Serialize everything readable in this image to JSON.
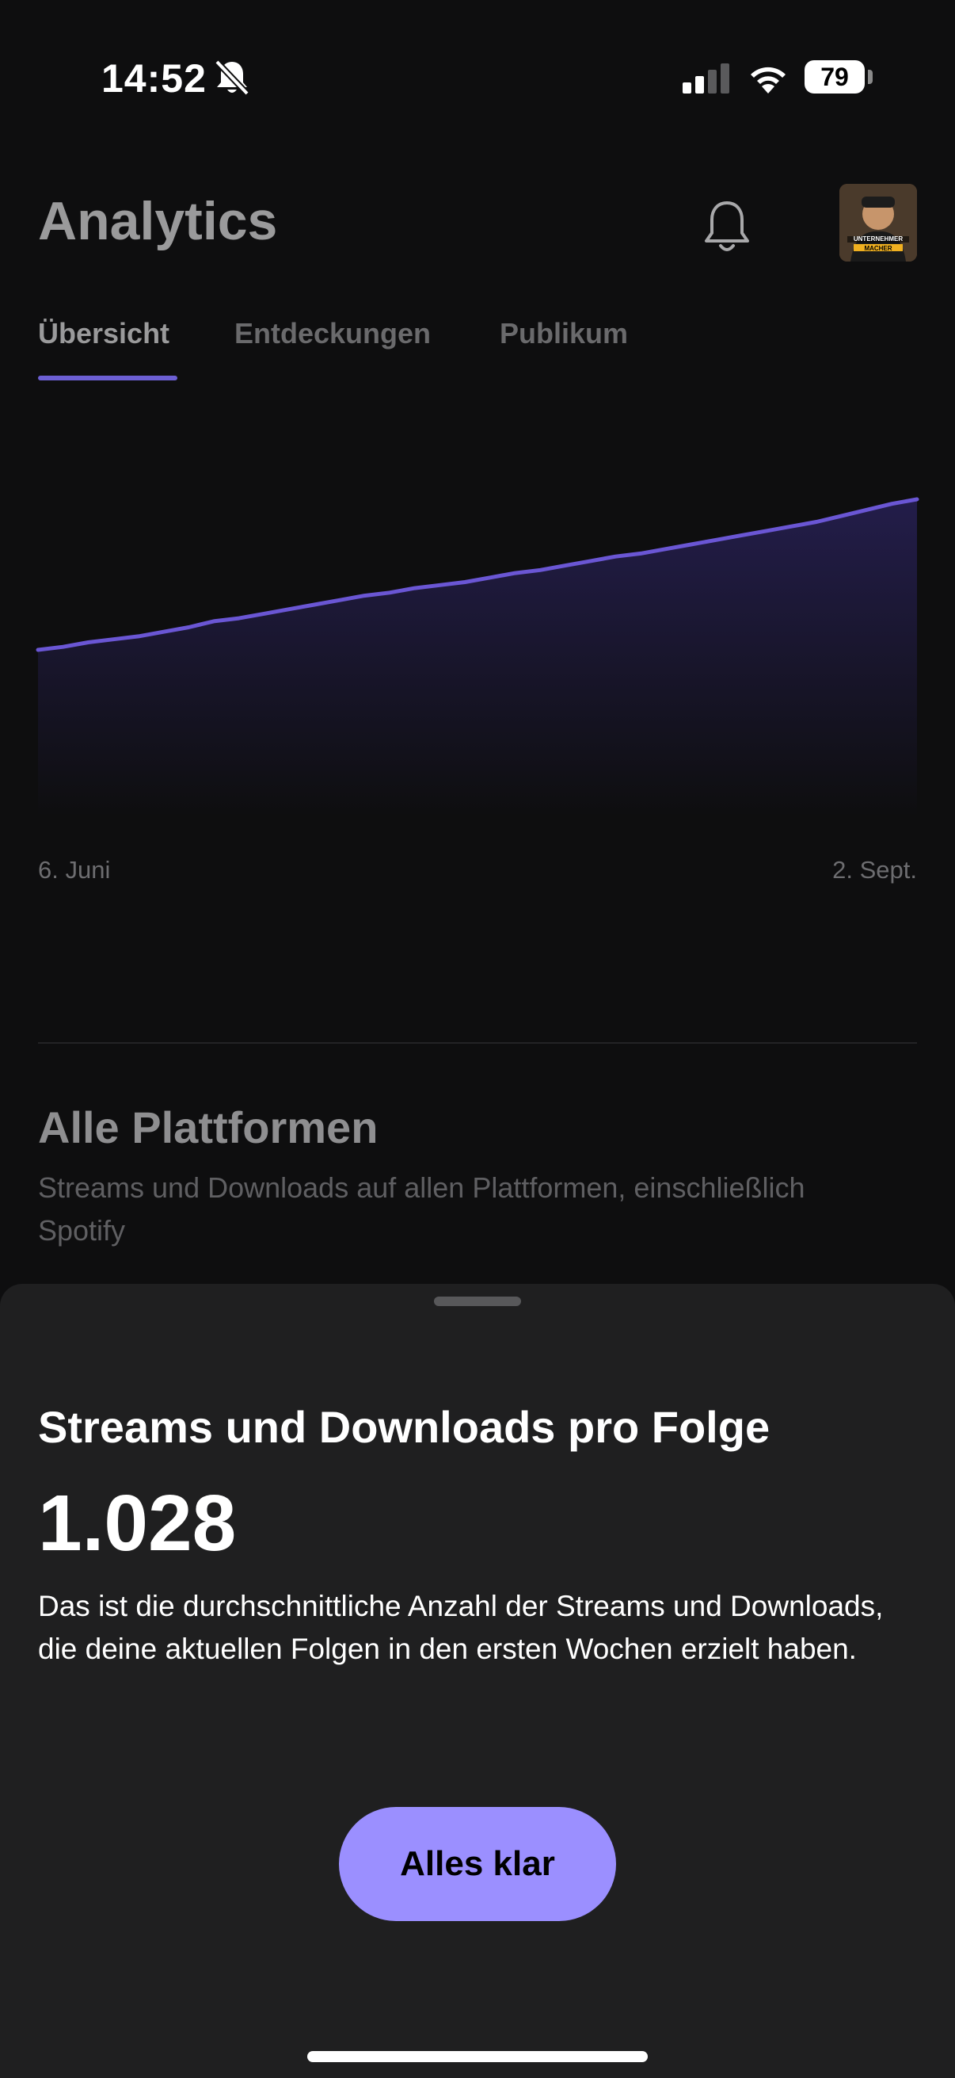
{
  "status_bar": {
    "time": "14:52",
    "battery": "79",
    "icons": [
      "bell-slash-icon",
      "cellular-signal-icon",
      "wifi-icon",
      "battery-icon"
    ]
  },
  "header": {
    "title": "Analytics",
    "bell_icon": "bell-icon",
    "avatar_text_1": "UNTERNEHMER",
    "avatar_text_2": "MACHER"
  },
  "tabs": [
    {
      "label": "Übersicht",
      "active": true
    },
    {
      "label": "Entdeckungen",
      "active": false
    },
    {
      "label": "Publikum",
      "active": false
    }
  ],
  "chart_data": {
    "type": "area",
    "x_start_label": "6. Juni",
    "x_end_label": "2. Sept.",
    "values": [
      0.0,
      0.02,
      0.05,
      0.07,
      0.09,
      0.12,
      0.15,
      0.19,
      0.21,
      0.24,
      0.27,
      0.3,
      0.33,
      0.36,
      0.38,
      0.41,
      0.43,
      0.45,
      0.48,
      0.51,
      0.53,
      0.56,
      0.59,
      0.62,
      0.64,
      0.67,
      0.7,
      0.73,
      0.76,
      0.79,
      0.82,
      0.85,
      0.89,
      0.93,
      0.97,
      1.0
    ],
    "line_color": "#6a56d4",
    "fill_color": "#231d4a",
    "grid": false
  },
  "section": {
    "title": "Alle Plattformen",
    "description": "Streams und Downloads auf allen Plattformen, einschließlich Spotify"
  },
  "sheet": {
    "title": "Streams und Downloads pro Folge",
    "value": "1.028",
    "description": "Das ist die durchschnittliche Anzahl der Streams und Downloads, die deine aktuellen Folgen in den ersten Wochen erzielt haben.",
    "button_label": "Alles klar",
    "button_color": "#9b8fff"
  }
}
